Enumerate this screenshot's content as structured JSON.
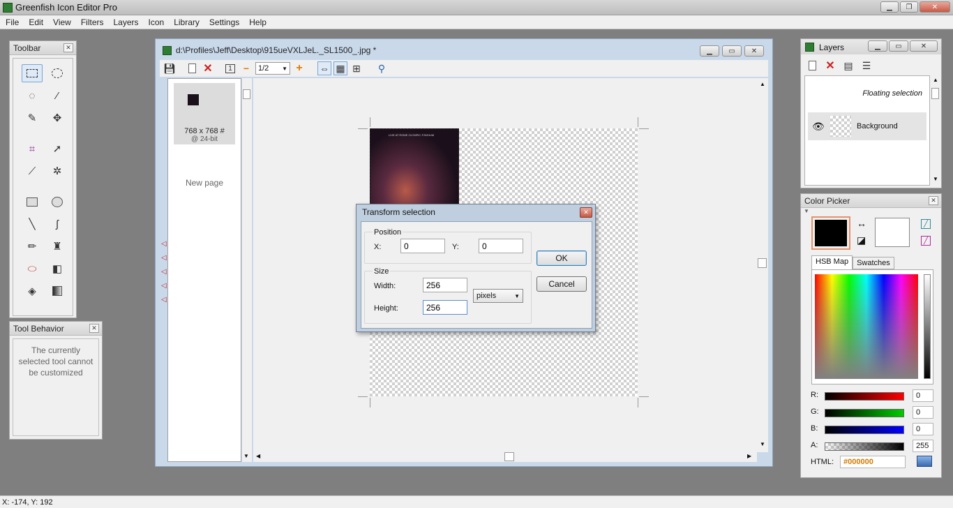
{
  "app": {
    "title": "Greenfish Icon Editor Pro"
  },
  "menu": [
    "File",
    "Edit",
    "View",
    "Filters",
    "Layers",
    "Icon",
    "Library",
    "Settings",
    "Help"
  ],
  "toolbar_panel": {
    "title": "Toolbar"
  },
  "tool_behavior": {
    "title": "Tool Behavior",
    "message": "The currently selected tool cannot be customized"
  },
  "document": {
    "title": "d:\\Profiles\\Jeff\\Desktop\\915ueVXLJeL._SL1500_.jpg *",
    "zoom": "1/2",
    "page_icon_size": "768 x 768 #",
    "page_icon_depth": "@ 24-bit",
    "new_page_label": "New page",
    "album_text": "LIVE AT ROME OLYMPIC STADIUM"
  },
  "dialog": {
    "title": "Transform selection",
    "position_label": "Position",
    "x_label": "X:",
    "x_value": "0",
    "y_label": "Y:",
    "y_value": "0",
    "size_label": "Size",
    "width_label": "Width:",
    "width_value": "256",
    "height_label": "Height:",
    "height_value": "256",
    "unit": "pixels",
    "ok_label": "OK",
    "cancel_label": "Cancel"
  },
  "layers_panel": {
    "title": "Layers",
    "layers": [
      {
        "name": "Floating selection"
      },
      {
        "name": "Background"
      }
    ]
  },
  "color_picker": {
    "title": "Color Picker",
    "tabs": [
      "HSB Map",
      "Swatches"
    ],
    "primary_color": "#000000",
    "secondary_color": "#ffffff",
    "r_label": "R:",
    "r": "0",
    "g_label": "G:",
    "g": "0",
    "b_label": "B:",
    "b": "0",
    "a_label": "A:",
    "a": "255",
    "html_label": "HTML:",
    "html_value": "#000000"
  },
  "status": {
    "coords": "X: -174, Y: 192"
  }
}
